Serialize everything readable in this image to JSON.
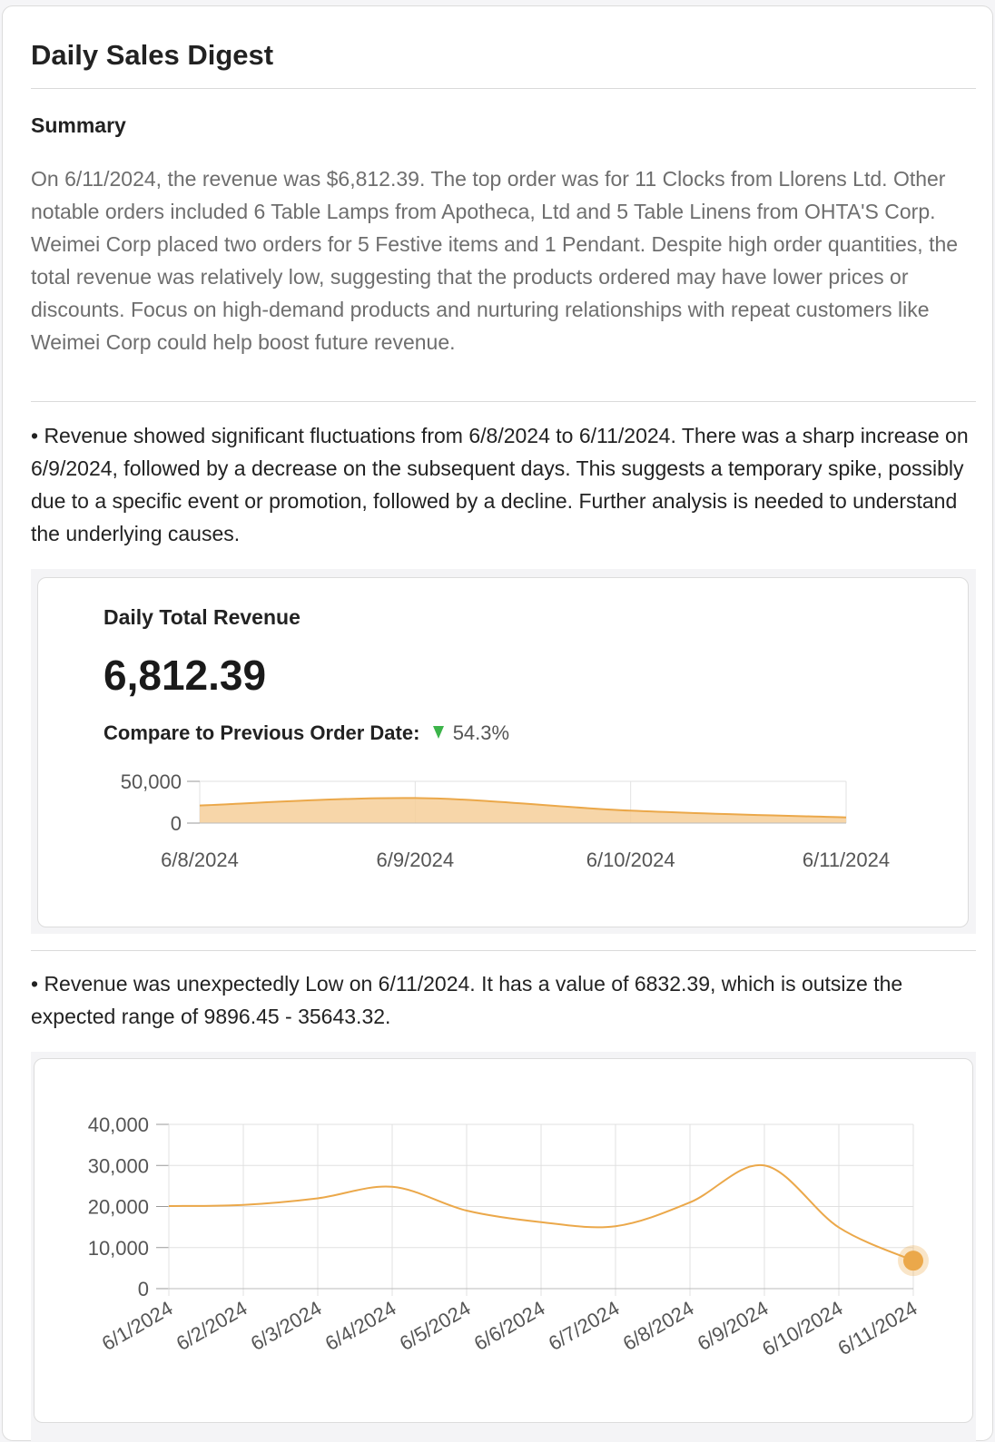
{
  "title": "Daily Sales Digest",
  "summary": {
    "heading": "Summary",
    "text": "On 6/11/2024, the revenue was $6,812.39. The top order was for 11 Clocks from Llorens Ltd. Other notable orders included 6 Table Lamps from Apotheca, Ltd and 5 Table Linens from OHTA'S Corp. Weimei Corp placed two orders for 5 Festive items and 1 Pendant. Despite high order quantities, the total revenue was relatively low, suggesting that the products ordered may have lower prices or discounts. Focus on high-demand products and nurturing relationships with repeat customers like Weimei Corp could help boost future revenue."
  },
  "insight1": {
    "text": "• Revenue showed significant fluctuations from 6/8/2024 to 6/11/2024. There was a sharp increase on 6/9/2024, followed by a decrease on the subsequent days. This suggests a temporary spike, possibly due to a specific event or promotion, followed by a decline. Further analysis is needed to understand the underlying causes."
  },
  "kpi": {
    "label": "Daily Total Revenue",
    "value": "6,812.39",
    "compare_label": "Compare to Previous Order Date:",
    "change_icon": "triangle-down-icon",
    "change_color": "#3cb44a",
    "change_value": "54.3%"
  },
  "insight2": {
    "text": "• Revenue was unexpectedly Low on 6/11/2024. It has a value of 6832.39, which is outsize the expected range of 9896.45 - 35643.32."
  },
  "chart_data": [
    {
      "type": "area",
      "x": [
        "6/8/2024",
        "6/9/2024",
        "6/10/2024",
        "6/11/2024"
      ],
      "values": [
        21000,
        30000,
        14900,
        6812.39
      ],
      "yticks": [
        "50,000",
        "0"
      ],
      "ylim": [
        0,
        50000
      ],
      "color": "#eba84a",
      "fill": "#f6cf9a"
    },
    {
      "type": "line",
      "x": [
        "6/1/2024",
        "6/2/2024",
        "6/3/2024",
        "6/4/2024",
        "6/5/2024",
        "6/6/2024",
        "6/7/2024",
        "6/8/2024",
        "6/9/2024",
        "6/10/2024",
        "6/11/2024"
      ],
      "values": [
        20100,
        20400,
        22000,
        24800,
        19000,
        16200,
        15200,
        21000,
        30000,
        14900,
        6812.39
      ],
      "yticks": [
        "40,000",
        "30,000",
        "20,000",
        "10,000",
        "0"
      ],
      "ylim": [
        0,
        40000
      ],
      "grid": true,
      "highlight": "6/11/2024",
      "color": "#eba84a"
    }
  ]
}
